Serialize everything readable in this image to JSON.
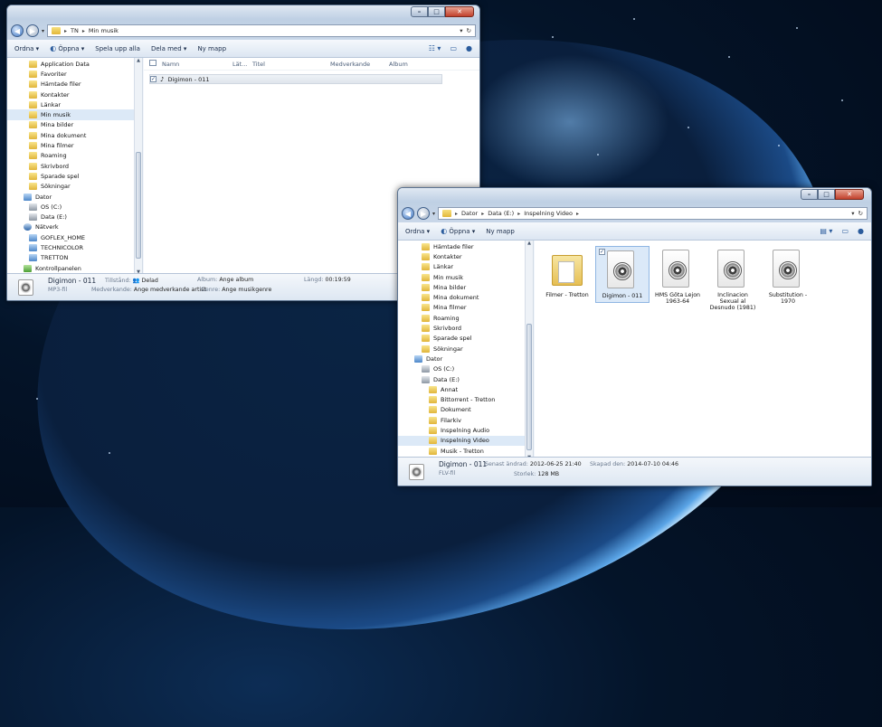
{
  "window1": {
    "address": {
      "crumbs": [
        "TN",
        "Min musik"
      ]
    },
    "toolbar": {
      "items": [
        "Ordna",
        "Öppna",
        "Spela upp alla",
        "Dela med",
        "Ny mapp"
      ]
    },
    "nav_items": [
      {
        "label": "Application Data",
        "icon": "folder-icon"
      },
      {
        "label": "Favoriter",
        "icon": "folder-icon"
      },
      {
        "label": "Hämtade filer",
        "icon": "folder-icon"
      },
      {
        "label": "Kontakter",
        "icon": "folder-icon"
      },
      {
        "label": "Länkar",
        "icon": "folder-icon"
      },
      {
        "label": "Min musik",
        "icon": "folder-icon",
        "selected": true
      },
      {
        "label": "Mina bilder",
        "icon": "folder-icon"
      },
      {
        "label": "Mina dokument",
        "icon": "folder-icon"
      },
      {
        "label": "Mina filmer",
        "icon": "folder-icon"
      },
      {
        "label": "Roaming",
        "icon": "folder-icon"
      },
      {
        "label": "Skrivbord",
        "icon": "folder-icon"
      },
      {
        "label": "Sparade spel",
        "icon": "folder-icon"
      },
      {
        "label": "Sökningar",
        "icon": "folder-icon"
      },
      {
        "label": "Dator",
        "icon": "computer-icon"
      },
      {
        "label": "OS (C:)",
        "icon": "drive-icon"
      },
      {
        "label": "Data (E:)",
        "icon": "drive-icon"
      },
      {
        "label": "Nätverk",
        "icon": "network-icon"
      },
      {
        "label": "GOFLEX_HOME",
        "icon": "network-computer-icon"
      },
      {
        "label": "TECHNICOLOR",
        "icon": "network-computer-icon"
      },
      {
        "label": "TRETTON",
        "icon": "network-computer-icon"
      },
      {
        "label": "Kontrollpanelen",
        "icon": "control-panel-icon"
      }
    ],
    "columns": [
      "Namn",
      "Lät...",
      "Titel",
      "Medverkande",
      "Album"
    ],
    "file": {
      "name": "Digimon - 011"
    },
    "details": {
      "title": "Digimon - 011",
      "type": "MP3-fil",
      "state_label": "Tillstånd:",
      "state_value": "Delad",
      "contrib_label": "Medverkande:",
      "contrib_value": "Ange medverkande artist",
      "album_label": "Album:",
      "album_value": "Ange album",
      "genre_label": "Genre:",
      "genre_value": "Ange musikgenre",
      "length_label": "Längd:",
      "length_value": "00:19:59"
    }
  },
  "window2": {
    "address": {
      "crumbs": [
        "Dator",
        "Data (E:)",
        "Inspelning Video"
      ]
    },
    "toolbar": {
      "items": [
        "Ordna",
        "Öppna",
        "Ny mapp"
      ]
    },
    "nav_items": [
      {
        "label": "Hämtade filer",
        "indent": 1
      },
      {
        "label": "Kontakter",
        "indent": 1
      },
      {
        "label": "Länkar",
        "indent": 1
      },
      {
        "label": "Min musik",
        "indent": 1
      },
      {
        "label": "Mina bilder",
        "indent": 1
      },
      {
        "label": "Mina dokument",
        "indent": 1
      },
      {
        "label": "Mina filmer",
        "indent": 1
      },
      {
        "label": "Roaming",
        "indent": 1
      },
      {
        "label": "Skrivbord",
        "indent": 1
      },
      {
        "label": "Sparade spel",
        "indent": 1
      },
      {
        "label": "Sökningar",
        "indent": 1
      },
      {
        "label": "Dator",
        "indent": 0
      },
      {
        "label": "OS (C:)",
        "indent": 1
      },
      {
        "label": "Data (E:)",
        "indent": 1
      },
      {
        "label": "Annat",
        "indent": 2
      },
      {
        "label": "Bittorrent - Tretton",
        "indent": 2
      },
      {
        "label": "Dokument",
        "indent": 2
      },
      {
        "label": "Filarkiv",
        "indent": 2
      },
      {
        "label": "Inspelning Audio",
        "indent": 2
      },
      {
        "label": "Inspelning Video",
        "indent": 2,
        "selected": true
      },
      {
        "label": "Musik - Tretton",
        "indent": 2
      }
    ],
    "files": [
      {
        "name": "Filmer - Tretton",
        "kind": "folder"
      },
      {
        "name": "Digimon - 011",
        "kind": "video",
        "selected": true
      },
      {
        "name": "HMS Göta Lejon 1963-64",
        "kind": "video"
      },
      {
        "name": "Inclinacion Sexual al Desnudo (1981)",
        "kind": "video"
      },
      {
        "name": "Substitution - 1970",
        "kind": "video"
      }
    ],
    "details": {
      "title": "Digimon - 011",
      "type": "FLV-fil",
      "modified_label": "Senast ändrad:",
      "modified_value": "2012-06-25 21:40",
      "created_label": "Skapad den:",
      "created_value": "2014-07-10 04:46",
      "size_label": "Storlek:",
      "size_value": "128 MB"
    }
  }
}
